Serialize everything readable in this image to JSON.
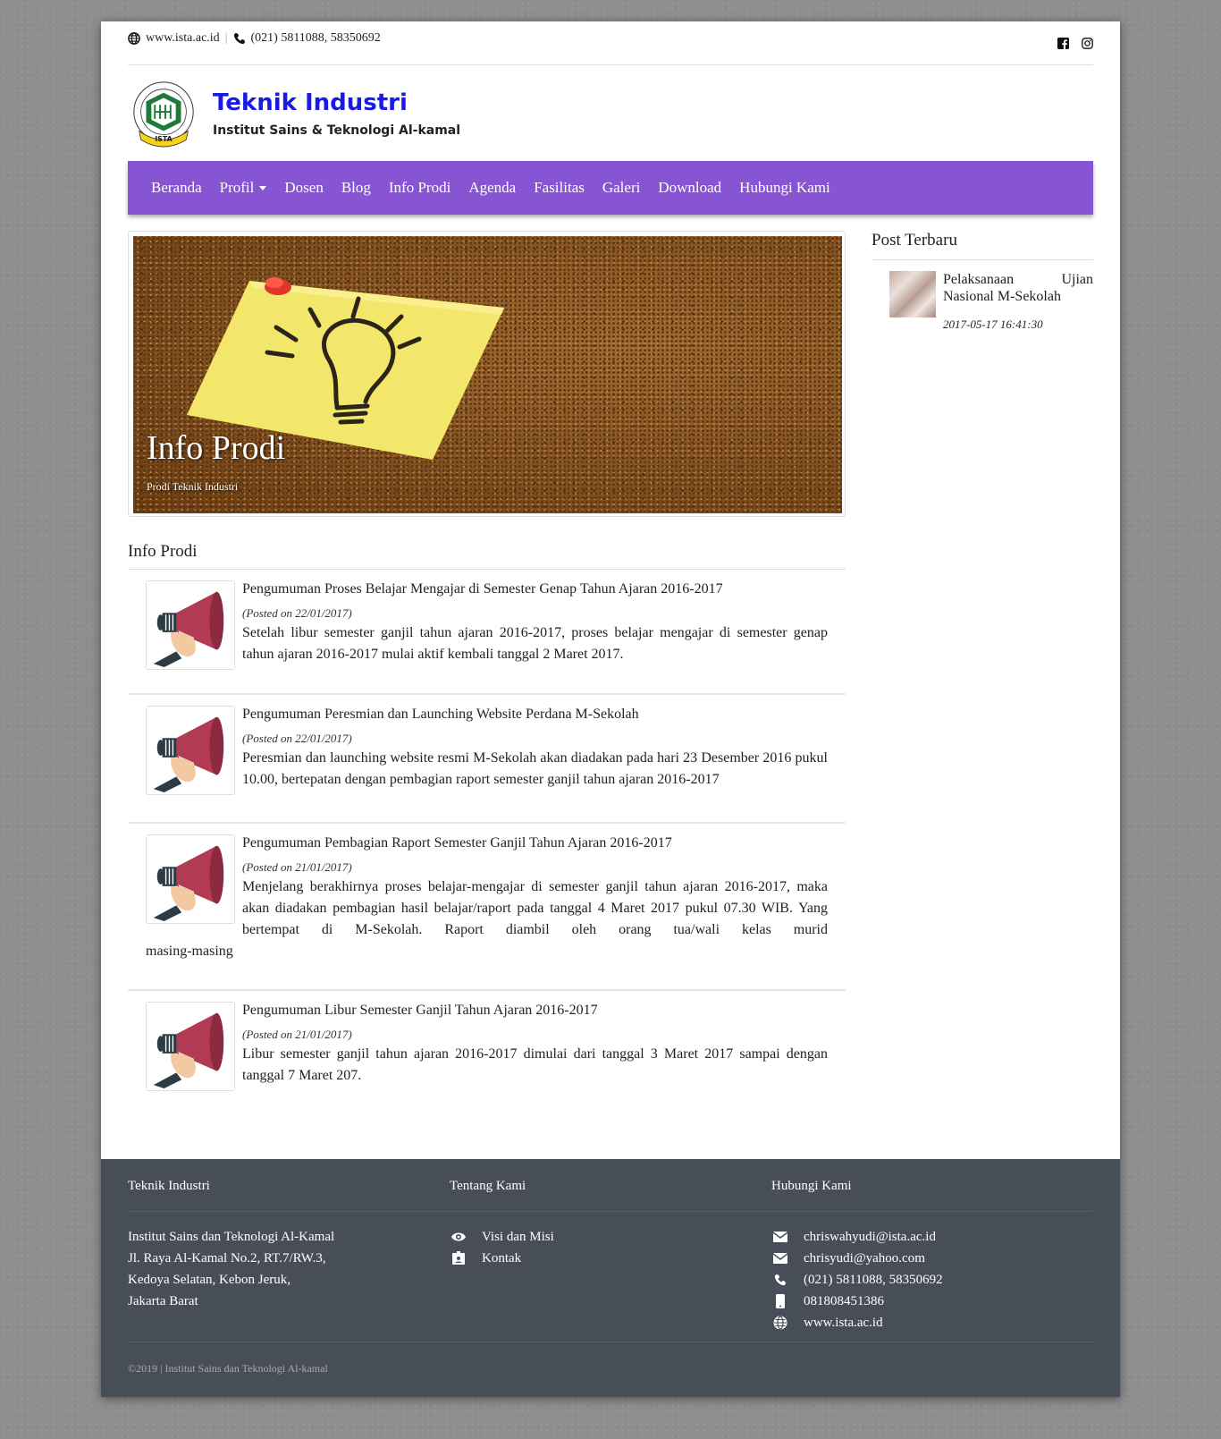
{
  "topbar": {
    "website": "www.ista.ac.id",
    "phone": "(021) 5811088, 58350692",
    "social": [
      "facebook-icon",
      "instagram-icon"
    ]
  },
  "header": {
    "logo_text": "ISTA",
    "title": "Teknik Industri",
    "subtitle": "Institut Sains & Teknologi Al-kamal"
  },
  "nav": {
    "items": [
      "Beranda",
      "Profil",
      "Dosen",
      "Blog",
      "Info Prodi",
      "Agenda",
      "Fasilitas",
      "Galeri",
      "Download",
      "Hubungi Kami"
    ],
    "color": "#8755d4"
  },
  "banner": {
    "title": "Info Prodi",
    "subtitle": "Prodi Teknik Industri"
  },
  "main": {
    "section_title": "Info Prodi",
    "posts": [
      {
        "title": "Pengumuman Proses Belajar Mengajar di Semester Genap Tahun Ajaran 2016-2017",
        "date": "(Posted on 22/01/2017)",
        "text": "Setelah libur semester ganjil tahun ajaran 2016-2017, proses belajar mengajar di semester genap tahun ajaran 2016-2017 mulai aktif kembali tanggal 2 Maret 2017."
      },
      {
        "title": "Pengumuman Peresmian dan Launching Website Perdana M-Sekolah",
        "date": "(Posted on 22/01/2017)",
        "text": "Peresmian dan launching website resmi M-Sekolah akan diadakan pada hari 23 Desember 2016 pukul 10.00, bertepatan dengan pembagian raport semester ganjil tahun ajaran 2016-2017"
      },
      {
        "title": "Pengumuman Pembagian Raport Semester Ganjil Tahun Ajaran 2016-2017",
        "date": "(Posted on 21/01/2017)",
        "text": "Menjelang berakhirnya proses belajar-mengajar di semester ganjil tahun ajaran 2016-2017, maka akan diadakan pembagian hasil belajar/raport pada tanggal 4 Maret 2017 pukul 07.30 WIB. Yang bertempat di M-Sekolah. Raport diambil oleh orang tua/wali kelas murid",
        "text_tail": "masing-masing"
      },
      {
        "title": "Pengumuman Libur Semester Ganjil Tahun Ajaran 2016-2017",
        "date": "(Posted on 21/01/2017)",
        "text": "Libur semester ganjil tahun ajaran 2016-2017 dimulai dari tanggal 3 Maret 2017 sampai dengan tanggal 7 Maret 207."
      }
    ]
  },
  "sidebar": {
    "title": "Post Terbaru",
    "recent": [
      {
        "title": "Pelaksanaan Ujian Nasional M-Sekolah",
        "date": "2017-05-17 16:41:30"
      }
    ]
  },
  "footer": {
    "col1": {
      "title": "Teknik Industri",
      "lines": [
        "Institut Sains dan Teknologi Al-Kamal",
        "Jl. Raya Al-Kamal No.2, RT.7/RW.3,",
        "Kedoya Selatan, Kebon Jeruk,",
        "Jakarta Barat"
      ]
    },
    "col2": {
      "title": "Tentang Kami",
      "links": [
        {
          "label": "Visi dan Misi",
          "icon": "eye-icon"
        },
        {
          "label": "Kontak",
          "icon": "id-card-icon"
        }
      ]
    },
    "col3": {
      "title": "Hubungi Kami",
      "items": [
        {
          "label": "chriswahyudi@ista.ac.id",
          "icon": "envelope-icon"
        },
        {
          "label": "chrisyudi@yahoo.com",
          "icon": "envelope-icon"
        },
        {
          "label": "(021) 5811088, 58350692",
          "icon": "phone-icon"
        },
        {
          "label": "081808451386",
          "icon": "mobile-icon"
        },
        {
          "label": "www.ista.ac.id",
          "icon": "globe-icon"
        }
      ]
    },
    "copyright": "©2019 | Institut Sains dan Teknologi Al-kamal",
    "bg_color": "#484e57"
  }
}
